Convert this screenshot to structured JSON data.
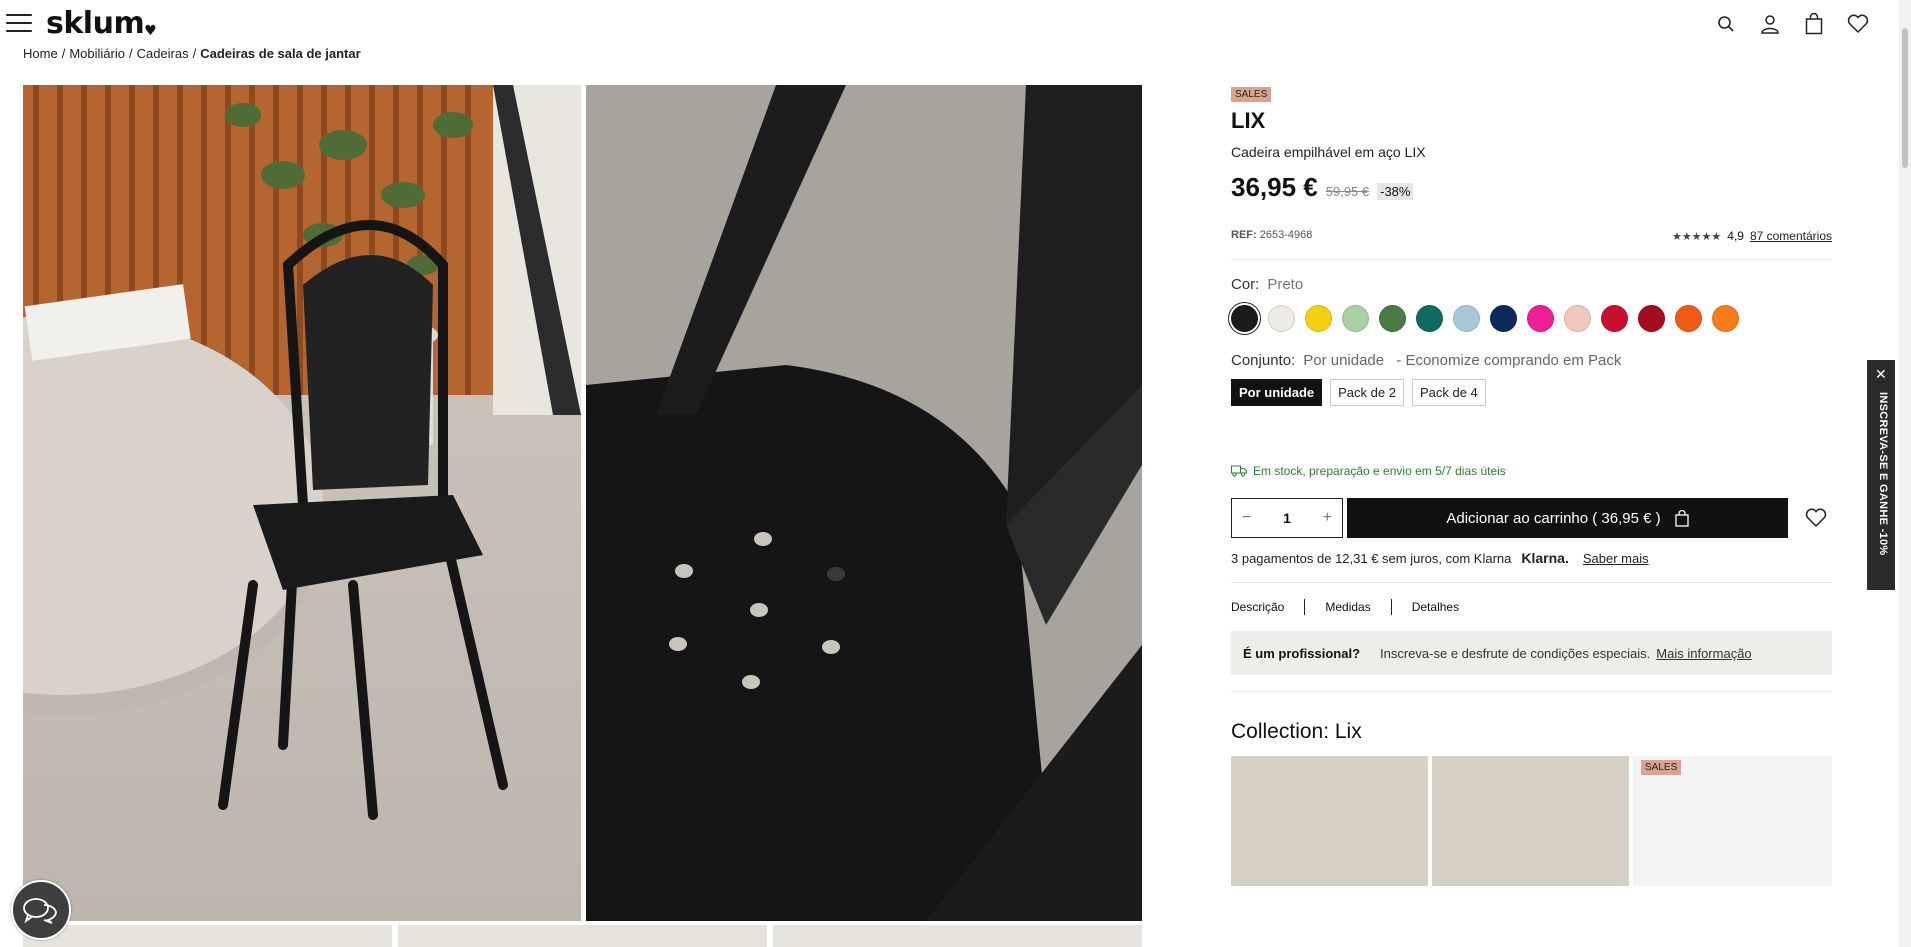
{
  "header": {
    "logo": "sklum",
    "logo_heart": "♥"
  },
  "breadcrumb": {
    "items": [
      "Home",
      "Mobiliário",
      "Cadeiras"
    ],
    "current": "Cadeiras de sala de jantar"
  },
  "product": {
    "badge": "SALES",
    "name": "LIX",
    "subtitle": "Cadeira empilhável em aço LIX",
    "price": "36,95 €",
    "old_price": "59,95 €",
    "discount": "-38%",
    "ref_label": "REF:",
    "ref_value": "2653-4968",
    "stars": "★★★★★",
    "rating": "4,9",
    "reviews_link": "87 comentários",
    "rating_value": 4.9
  },
  "color": {
    "label": "Cor:",
    "selected": "Preto",
    "swatches": [
      "#1b1b1b",
      "#eeebe4",
      "#f5cf12",
      "#a9d1a6",
      "#4a7a45",
      "#0f6b60",
      "#a8c8d8",
      "#0d2a5c",
      "#ee1f93",
      "#f2c7bd",
      "#c8102e",
      "#a30c1c",
      "#f15a15",
      "#f67c1c"
    ]
  },
  "set": {
    "label": "Conjunto:",
    "selected": "Por unidade",
    "note": "- Economize comprando em Pack",
    "options": [
      "Por unidade",
      "Pack de 2",
      "Pack de 4"
    ]
  },
  "stock_text": "Em stock, preparação e envio em 5/7 dias úteis",
  "cart": {
    "minus": "−",
    "qty": "1",
    "plus": "+",
    "button": "Adicionar ao carrinho ( 36,95 € )"
  },
  "klarna": {
    "text": "3 pagamentos de 12,31 € sem juros, com Klarna",
    "brand": "Klarna.",
    "link": "Saber mais"
  },
  "tabs": [
    "Descrição",
    "Medidas",
    "Detalhes"
  ],
  "pro": {
    "title": "É um profissional?",
    "text": "Inscreva-se e desfrute de condições especiais.",
    "link": "Mais informação"
  },
  "collection": {
    "title": "Collection: Lix",
    "badge": "SALES"
  },
  "promo": {
    "close": "✕",
    "text": "INSCREVA-SE E GANHE -10%"
  }
}
